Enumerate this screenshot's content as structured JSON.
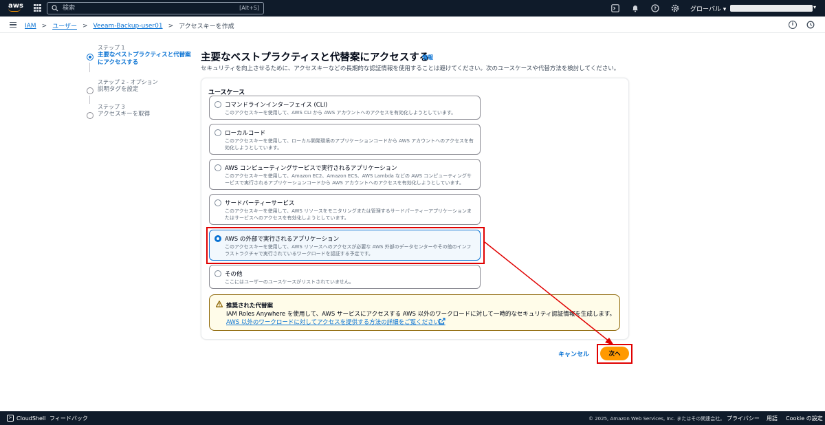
{
  "topnav": {
    "logo_text": "aws",
    "search_placeholder": "検索",
    "search_shortcut": "[Alt+S]",
    "region_label": "グローバル ▾",
    "icons": [
      "terminal-icon",
      "bell-icon",
      "help-icon",
      "settings-icon"
    ]
  },
  "breadcrumb": {
    "items": [
      {
        "label": "IAM",
        "link": true
      },
      {
        "label": "ユーザー",
        "link": true
      },
      {
        "label": "Veeam-Backup-user01",
        "link": true
      },
      {
        "label": "アクセスキーを作成",
        "link": false
      }
    ],
    "separator": ">"
  },
  "steps": [
    {
      "num": "ステップ 1",
      "title": "主要なベストプラクティスと代替案にアクセスする",
      "active": true
    },
    {
      "num": "ステップ 2 - オプション",
      "title": "説明タグを設定",
      "active": false
    },
    {
      "num": "ステップ 3",
      "title": "アクセスキーを取得",
      "active": false
    }
  ],
  "header": {
    "title": "主要なベストプラクティスと代替案にアクセスする",
    "info_link": "情報",
    "description": "セキュリティを向上させるために、アクセスキーなどの長期的な認証情報を使用することは避けてください。次のユースケースや代替方法を検討してください。"
  },
  "usecase": {
    "label": "ユースケース",
    "options": [
      {
        "title": "コマンドラインインターフェイス (CLI)",
        "desc": "このアクセスキーを使用して、AWS CLI から AWS アカウントへのアクセスを有効化しようとしています。",
        "selected": false
      },
      {
        "title": "ローカルコード",
        "desc": "このアクセスキーを使用して、ローカル開発環境のアプリケーションコードから AWS アカウントへのアクセスを有効化しようとしています。",
        "selected": false
      },
      {
        "title": "AWS コンピューティングサービスで実行されるアプリケーション",
        "desc": "このアクセスキーを使用して、Amazon EC2、Amazon ECS、AWS Lambda などの AWS コンピューティングサービスで実行されるアプリケーションコードから AWS アカウントへのアクセスを有効化しようとしています。",
        "selected": false
      },
      {
        "title": "サードパーティーサービス",
        "desc": "このアクセスキーを使用して、AWS リソースをモニタリングまたは管理するサードパーティーアプリケーションまたはサービスへのアクセスを有効化しようとしています。",
        "selected": false
      },
      {
        "title": "AWS の外部で実行されるアプリケーション",
        "desc": "このアクセスキーを使用して、AWS リソースへのアクセスが必要な AWS 外部のデータセンターやその他のインフラストラクチャで実行されているワークロードを認証する予定です。",
        "selected": true
      },
      {
        "title": "その他",
        "desc": "ここにはユーザーのユースケースがリストされていません。",
        "selected": false
      }
    ]
  },
  "alert": {
    "title": "推奨された代替案",
    "body": "IAM Roles Anywhere を使用して、AWS サービスにアクセスする AWS 以外のワークロードに対して一時的なセキュリティ認証情報を生成します。",
    "link": "AWS 以外のワークロードに対してアクセスを提供する方法の詳細をご覧ください。"
  },
  "actions": {
    "cancel": "キャンセル",
    "next": "次へ"
  },
  "footer": {
    "cloudshell": "CloudShell",
    "feedback": "フィードバック",
    "copyright": "© 2025, Amazon Web Services, Inc. またはその関連会社。",
    "privacy": "プライバシー",
    "terms": "用語",
    "cookie": "Cookie の設定"
  },
  "colors": {
    "nav_bg": "#0f1b2a",
    "link": "#0972d3",
    "primary_button": "#ff9900",
    "annotation": "#e00000",
    "alert_border": "#8d6605",
    "alert_bg": "#fffce9"
  }
}
